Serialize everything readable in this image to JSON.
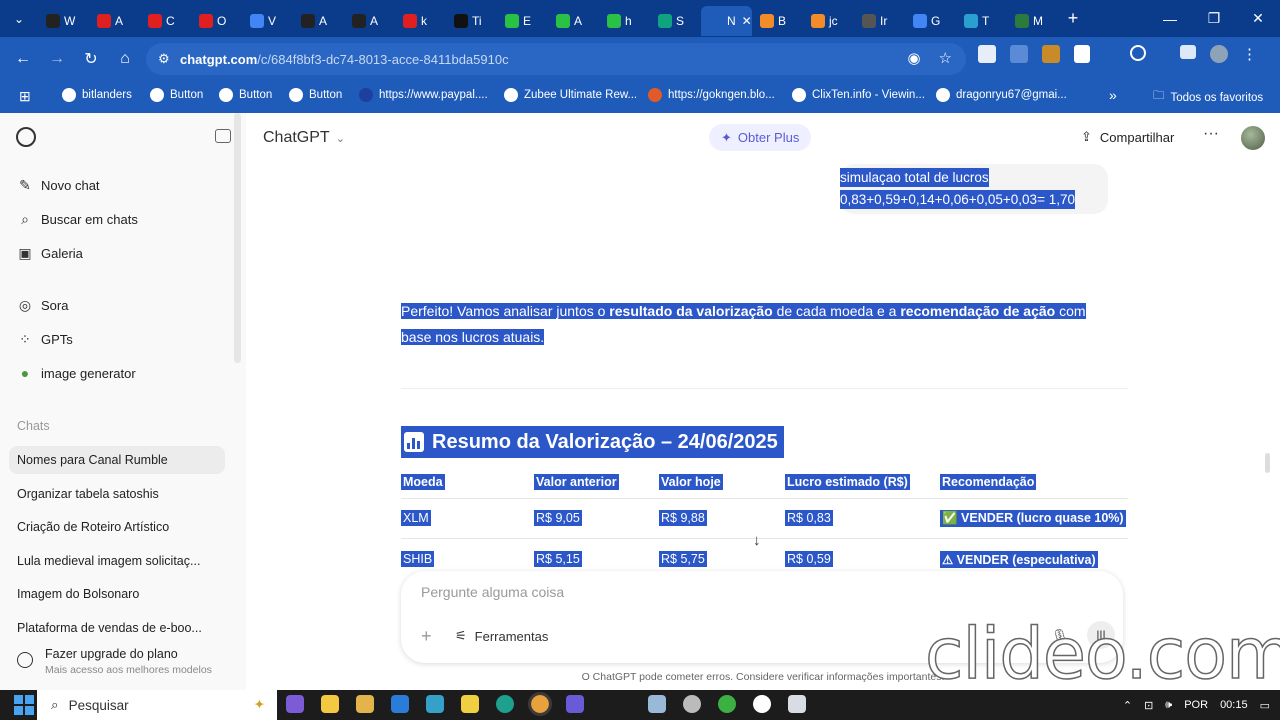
{
  "browser": {
    "tabs": [
      {
        "label": "W",
        "color": "#222"
      },
      {
        "label": "A",
        "color": "#e02020"
      },
      {
        "label": "C",
        "color": "#e02020"
      },
      {
        "label": "O",
        "color": "#e02020"
      },
      {
        "label": "V",
        "color": "#4285f4"
      },
      {
        "label": "A",
        "color": "#222"
      },
      {
        "label": "A",
        "color": "#222"
      },
      {
        "label": "k",
        "color": "#e02020"
      },
      {
        "label": "Ti",
        "color": "#111"
      },
      {
        "label": "E",
        "color": "#29c244"
      },
      {
        "label": "A",
        "color": "#29c244"
      },
      {
        "label": "h",
        "color": "#29c244"
      },
      {
        "label": "S",
        "color": "#10a37f"
      },
      {
        "label": "N",
        "color": "#1f5bb8",
        "active": true
      },
      {
        "label": "B",
        "color": "#f28c28"
      },
      {
        "label": "jc",
        "color": "#f28c28"
      },
      {
        "label": "Ir",
        "color": "#555"
      },
      {
        "label": "G",
        "color": "#4285f4"
      },
      {
        "label": "T",
        "color": "#2aa0d0"
      },
      {
        "label": "M",
        "color": "#2b7b3c"
      }
    ],
    "url_host": "chatgpt.com",
    "url_path": "/c/684f8bf3-dc74-8013-acce-8411bda5910c",
    "bookmarks": [
      "bitlanders",
      "Button",
      "Button",
      "Button",
      "https://www.paypal....",
      "Zubee Ultimate Rew...",
      "https://gokngen.blo...",
      "ClixTen.info - Viewin...",
      "dragonryu67@gmai..."
    ],
    "bookmarks_more": "»",
    "all_favorites": "Todos os favoritos"
  },
  "sidebar": {
    "items": [
      {
        "label": "Novo chat",
        "icon": "edit-icon",
        "glyph": "✎"
      },
      {
        "label": "Buscar em chats",
        "icon": "search-icon",
        "glyph": "⌕"
      },
      {
        "label": "Galeria",
        "icon": "gallery-icon",
        "glyph": "▣"
      },
      {
        "label": "Sora",
        "icon": "sora-icon",
        "glyph": "◎"
      },
      {
        "label": "GPTs",
        "icon": "gpts-icon",
        "glyph": "⁘"
      },
      {
        "label": "image generator",
        "icon": "image-generator-icon",
        "glyph": "●"
      }
    ],
    "chats_label": "Chats",
    "chats": [
      "Nomes para Canal Rumble",
      "Organizar tabela satoshis",
      "Criação de Roteiro Artístico",
      "Lula medieval imagem solicitaç...",
      "Imagem do Bolsonaro",
      "Plataforma de vendas de e-boo..."
    ],
    "upgrade_title": "Fazer upgrade do plano",
    "upgrade_sub": "Mais acesso aos melhores modelos"
  },
  "header": {
    "model": "ChatGPT",
    "plus_label": "Obter Plus",
    "share_label": "Compartilhar"
  },
  "conversation": {
    "user_line1": "simulaçao total de lucros",
    "user_line2": "0,83+0,59+0,14+0,06+0,05+0,03= 1,70",
    "reply_a": "Perfeito! Vamos analisar juntos o ",
    "reply_b": "resultado da valorização",
    "reply_c": " de cada moeda e a ",
    "reply_d": "recomendação de ação",
    "reply_e": " com base nos lucros atuais.",
    "heading": "Resumo da Valorização – 24/06/2025",
    "table": {
      "headers": [
        "Moeda",
        "Valor anterior",
        "Valor hoje",
        "Lucro estimado (R$)",
        "Recomendação"
      ],
      "rows": [
        [
          "XLM",
          "R$ 9,05",
          "R$ 9,88",
          "R$ 0,83",
          "✅ VENDER (lucro quase 10%)"
        ],
        [
          "SHIB",
          "R$ 5,15",
          "R$ 5,75",
          "R$ 0,59",
          "⚠ VENDER (especulativa)"
        ]
      ]
    }
  },
  "composer": {
    "placeholder": "Pergunte alguma coisa",
    "tools_label": "Ferramentas"
  },
  "disclaimer": "O ChatGPT pode cometer erros. Considere verificar informações importantes.",
  "watermark": "clideo.com",
  "taskbar": {
    "search_label": "Pesquisar",
    "lang": "POR",
    "time": "00:15"
  }
}
